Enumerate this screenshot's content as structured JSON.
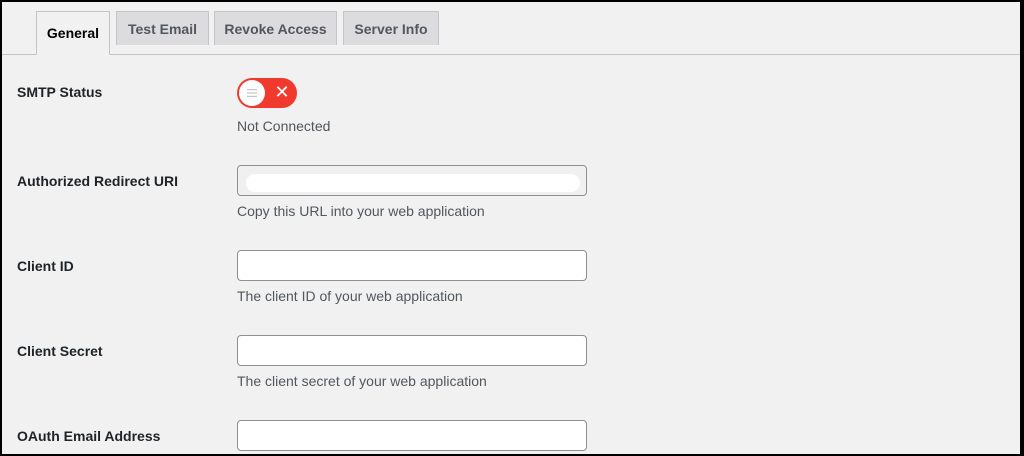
{
  "tabs": [
    {
      "label": "General",
      "active": true
    },
    {
      "label": "Test Email",
      "active": false
    },
    {
      "label": "Revoke Access",
      "active": false
    },
    {
      "label": "Server Info",
      "active": false
    }
  ],
  "smtp_status": {
    "label": "SMTP Status",
    "toggle_state": "off",
    "status_text": "Not Connected",
    "toggle_color": "#f03a2e"
  },
  "redirect_uri": {
    "label": "Authorized Redirect URI",
    "value": "",
    "description": "Copy this URL into your web application"
  },
  "client_id": {
    "label": "Client ID",
    "value": "",
    "description": "The client ID of your web application"
  },
  "client_secret": {
    "label": "Client Secret",
    "value": "",
    "description": "The client secret of your web application"
  },
  "oauth_email": {
    "label": "OAuth Email Address",
    "value": ""
  },
  "icons": {
    "knob": "menu-lines-icon",
    "off": "close-icon"
  }
}
